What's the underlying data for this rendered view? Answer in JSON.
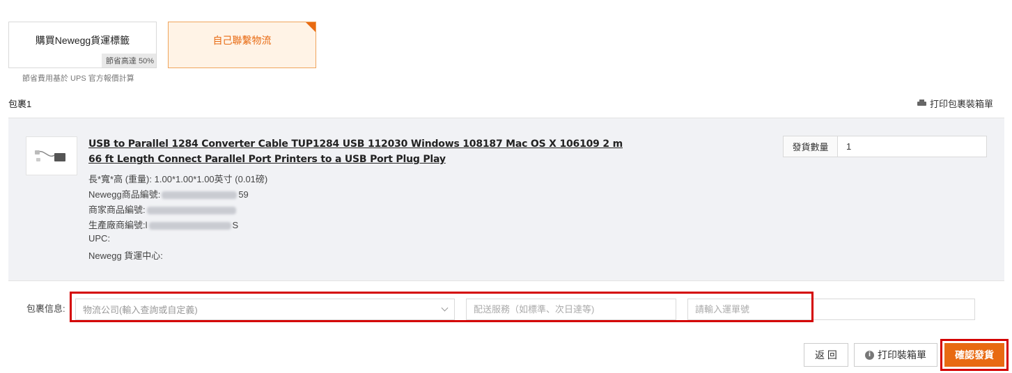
{
  "shipping_options": {
    "newegg_label": {
      "label": "購買Newegg貨運標籤",
      "save_tag": "節省高達 50%"
    },
    "self_ship": {
      "label": "自己聯繫物流"
    },
    "save_note": "節省費用基於 UPS 官方報價計算"
  },
  "package": {
    "title": "包裹1",
    "print_packing_label": "打印包裹裝箱單"
  },
  "item": {
    "title": "USB to Parallel 1284 Converter Cable TUP1284 USB 112030 Windows 108187 Mac OS X 106109 2 m 66 ft Length Connect Parallel Port Printers to a USB Port Plug Play",
    "dimensions_label": "長*寬*高 (重量):",
    "dimensions_value": "1.00*1.00*1.00英寸 (0.01磅)",
    "newegg_item_label": "Newegg商品編號:",
    "newegg_item_suffix": "59",
    "seller_item_label": "商家商品編號:",
    "mfr_item_label": "生產廠商編號:",
    "mfr_item_prefix": "l",
    "mfr_item_suffix": "S",
    "upc_label": "UPC:",
    "warehouse_label": "Newegg 貨運中心:",
    "qty_label": "發貨數量",
    "qty_value": "1"
  },
  "parcel": {
    "label": "包裹信息:",
    "carrier_placeholder": "物流公司(輸入查詢或自定義)",
    "service_placeholder": "配送服務（如標準、次日達等)",
    "tracking_placeholder": "請輸入運單號"
  },
  "actions": {
    "back": "返 回",
    "print_box": "打印裝箱單",
    "confirm": "確認發貨"
  },
  "colors": {
    "accent": "#e86a12",
    "highlight": "#d40000"
  }
}
